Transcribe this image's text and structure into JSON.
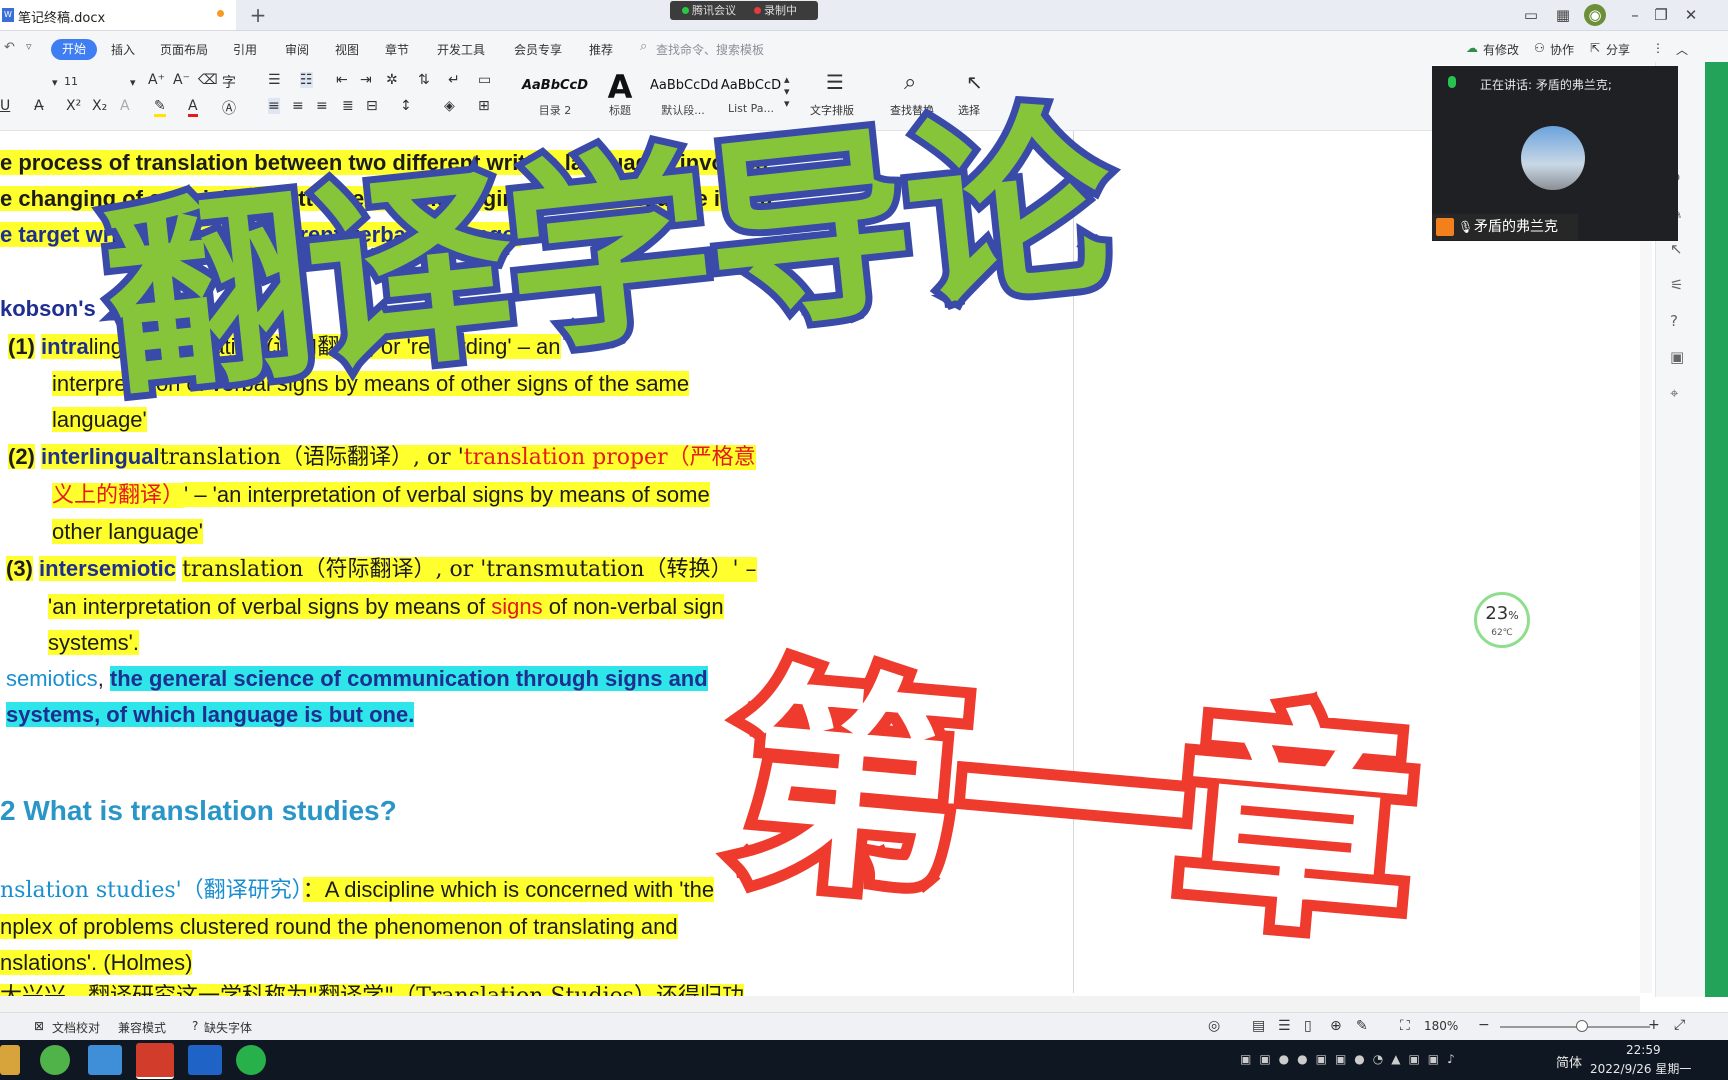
{
  "window": {
    "tab_title": "笔记终稿.docx",
    "doc_icon_text": "W",
    "add_tab": "+",
    "meeting_app": "腾讯会议",
    "recording": "录制中"
  },
  "ribbon": {
    "tabs": [
      "开始",
      "插入",
      "页面布局",
      "引用",
      "审阅",
      "视图",
      "章节",
      "开发工具",
      "会员专享",
      "推荐"
    ],
    "search_placeholder": "查找命令、搜索模板",
    "modified": "有修改",
    "collab": "协作",
    "share": "分享"
  },
  "toolbar": {
    "font_size": "11",
    "styles": [
      {
        "sample": "AaBbCcD",
        "name": "目录 2"
      },
      {
        "sample": "A",
        "name": "标题"
      },
      {
        "sample": "AaBbCcDd",
        "name": "默认段..."
      },
      {
        "sample": "AaBbCcD",
        "name": "List Pa..."
      }
    ],
    "text_layout": "文字排版",
    "find_replace": "查找替换",
    "select": "选择"
  },
  "meeting": {
    "speaking_label": "正在讲话: 矛盾的弗兰克;",
    "participant_name": "矛盾的弗兰克"
  },
  "document": {
    "l1": "e process of translation between two different written languages involves",
    "l2": "e changing of an original written text in the original verbal language into a",
    "l3": "e target written text in a different verbal language.",
    "jakobson": "kobson's",
    "j1_num": "(1)",
    "j1_word": "intra",
    "j1_rest": "lingual translation (语内翻译), or 'rewording' – an",
    "j1b": "interpretation of verbal signs by means of other signs of the same",
    "j1c": "language'",
    "j2_num": "(2)",
    "j2_word": "interlingual",
    "j2_mid": "translation（语际翻译）, or '",
    "j2_red": "translation proper（严格意",
    "j2b_red": "义上的翻译）",
    "j2b_rest": "' – 'an interpretation of verbal signs by means of some",
    "j2c": "other language'",
    "j3_num": "(3)",
    "j3_word": "intersemiotic",
    "j3_rest": "translation（符际翻译）, or 'transmutation（转换）' –",
    "j3b_a": "'an interpretation of verbal signs by means of ",
    "j3b_red": "signs",
    "j3b_b": " of non-verbal sign",
    "j3c": "systems'.",
    "sem_word": "semiotics",
    "sem_comma": ", ",
    "sem_cyan": "the general science of communication through signs and",
    "sem2": "systems, of which language is but one.",
    "heading": "2 What is translation studies?",
    "ts_term": "nslation studies'（翻译研究）",
    "ts_rest": "：A discipline which is concerned with 'the",
    "ts2": "nplex of problems clustered round the phenomenon of translating and",
    "ts3": "nslations'. (Holmes)",
    "ts4": "大兴兴，翻译研究这一学科称为\"翻译学\"（Translation Studies）还得归功"
  },
  "overlay": {
    "title": "翻译学导论",
    "chapter": "第一章"
  },
  "perf_widget": {
    "percent": "23",
    "percent_sign": "%",
    "temp": "62℃"
  },
  "statusbar": {
    "doc_check": "文档校对",
    "compat": "兼容模式",
    "missing_font": "缺失字体",
    "zoom": "180%"
  },
  "taskbar": {
    "time": "22:59",
    "date": "2022/9/26 星期一",
    "ime": "简体"
  },
  "colors": {
    "accent": "#3f7ef2",
    "highlight_yellow": "#ffff2e",
    "highlight_cyan": "#2ee6ea",
    "title_green": "#86c53a",
    "title_outline": "#3a4aa8",
    "chapter_red": "#ef3a2e"
  }
}
